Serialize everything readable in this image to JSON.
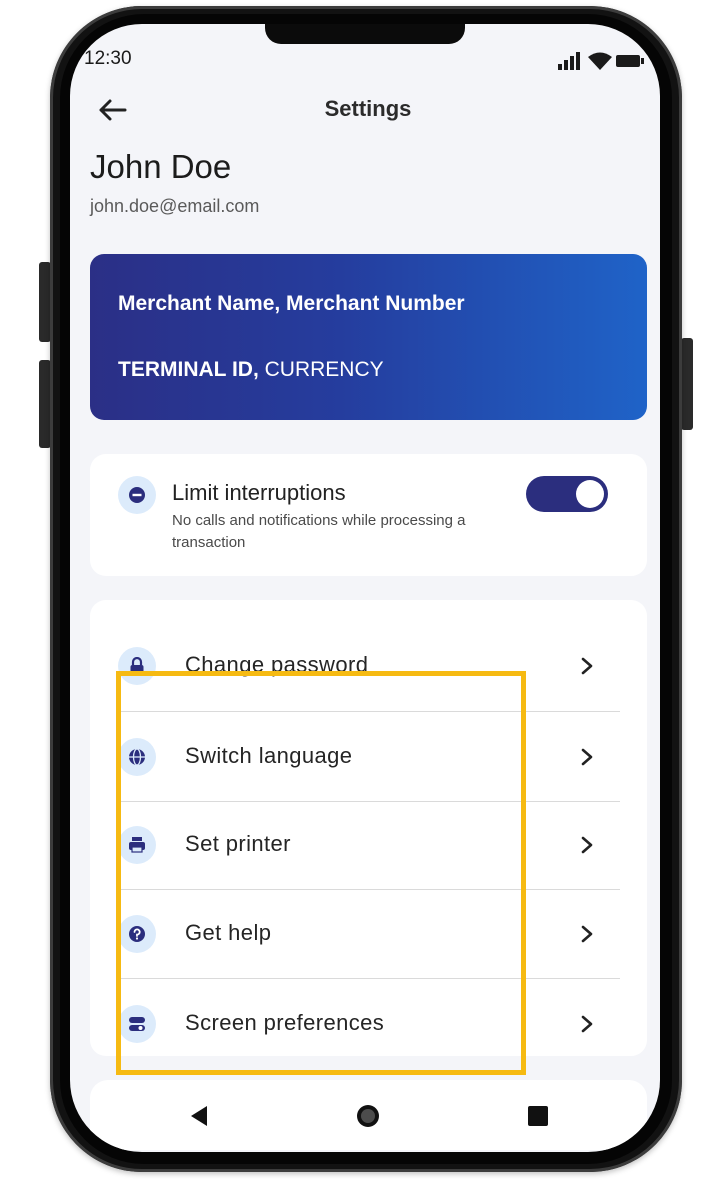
{
  "status_bar": {
    "time": "12:30",
    "icons": [
      "signal-icon",
      "wifi-icon",
      "battery-icon"
    ]
  },
  "header": {
    "back_icon": "back-arrow-icon",
    "title": "Settings"
  },
  "profile": {
    "name": "John Doe",
    "email": "john.doe@email.com"
  },
  "merchant_card": {
    "line1": "Merchant Name, Merchant Number",
    "terminal_label": "TERMINAL ID,",
    "currency_label": "CURRENCY",
    "gradient_start": "#2b2f86",
    "gradient_end": "#1f63c8"
  },
  "interruptions": {
    "icon": "minus-circle-icon",
    "title": "Limit interruptions",
    "subtitle": "No calls and notifications while processing a transaction",
    "enabled": true,
    "toggle_color": "#2b2e7e"
  },
  "menu": {
    "items": [
      {
        "label": "Change password",
        "icon": "lock-icon"
      },
      {
        "label": "Switch language",
        "icon": "globe-icon"
      },
      {
        "label": "Set printer",
        "icon": "printer-icon"
      },
      {
        "label": "Get help",
        "icon": "help-icon"
      },
      {
        "label": "Screen preferences",
        "icon": "screen-preferences-icon"
      }
    ]
  },
  "nav_bar": {
    "buttons": [
      "back-triangle-icon",
      "home-circle-icon",
      "recents-square-icon"
    ]
  },
  "colors": {
    "accent": "#2b2e7e",
    "icon_badge": "#dcebfb",
    "highlight": "#f6ba12",
    "background": "#f4f5f9"
  }
}
